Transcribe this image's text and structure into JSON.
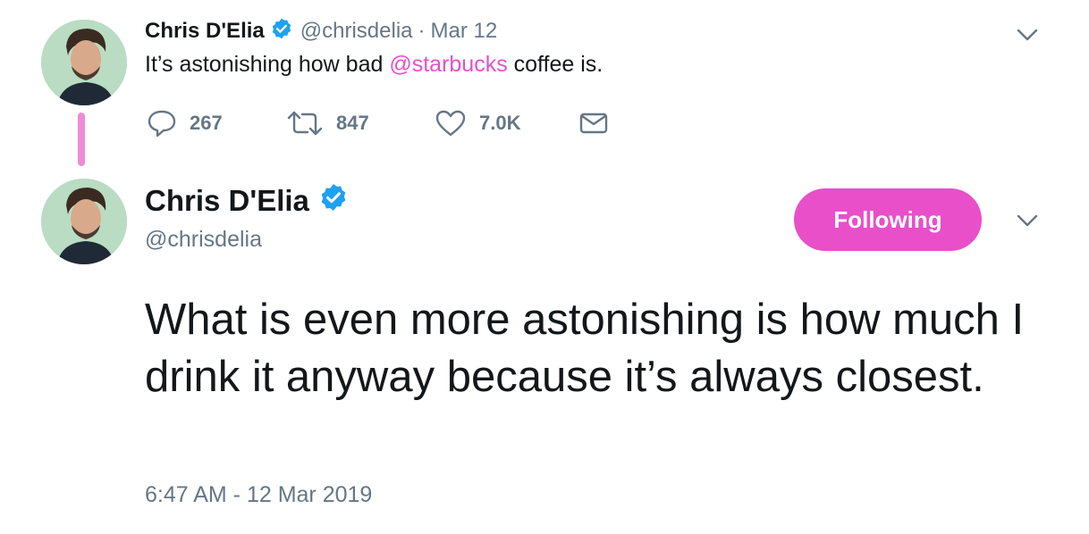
{
  "parent_tweet": {
    "name": "Chris D'Elia",
    "handle": "@chrisdelia",
    "separator": "·",
    "date": "Mar 12",
    "text_before": "It’s astonishing how bad ",
    "mention": "@starbucks",
    "text_after": " coffee is.",
    "replies": "267",
    "retweets": "847",
    "likes": "7.0K"
  },
  "main_tweet": {
    "name": "Chris D'Elia",
    "handle": "@chrisdelia",
    "follow_label": "Following",
    "text": "What is even more astonishing is how much I drink it anyway because it’s always closest.",
    "timestamp": "6:47 AM - 12 Mar 2019"
  },
  "icons": {
    "verified": "verified-badge-icon",
    "reply": "reply-icon",
    "retweet": "retweet-icon",
    "like": "heart-icon",
    "dm": "envelope-icon",
    "menu": "chevron-down-icon"
  },
  "colors": {
    "accent": "#e94fc9",
    "thread_line": "#f08ad8",
    "verified": "#1da1f2",
    "secondary_text": "#657786",
    "primary_text": "#14171a"
  }
}
